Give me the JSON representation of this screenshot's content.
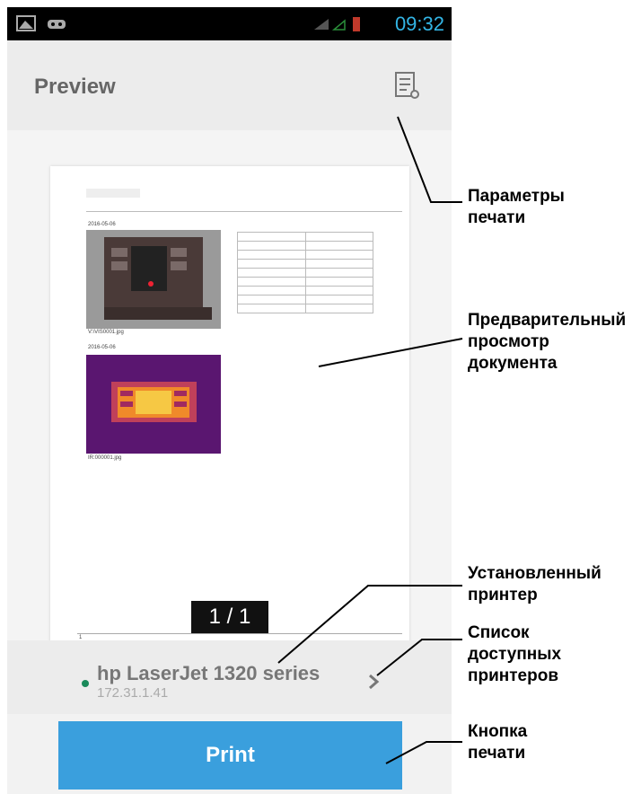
{
  "status_bar": {
    "time": "09:32"
  },
  "app_bar": {
    "title": "Preview",
    "options_icon": "print-settings-icon"
  },
  "document": {
    "date1": "2016-05-06",
    "caption1": "V:\\VIS0001.jpg",
    "date2": "2016-05-06",
    "caption2": "IR:000001.jpg",
    "page_number": "1"
  },
  "pager": {
    "label": "1 / 1"
  },
  "printer": {
    "name": "hp LaserJet 1320 series",
    "ip": "172.31.1.41"
  },
  "print_button": {
    "label": "Print"
  },
  "annotations": {
    "print_settings": "Параметры\nпечати",
    "doc_preview": "Предварительный\nпросмотр\nдокумента",
    "installed_printer": "Установленный\nпринтер",
    "printer_list": "Список\nдоступных\nпринтеров",
    "print_button": "Кнопка\nпечати"
  },
  "colors": {
    "accent": "#3a9fdd",
    "status_text": "#33b5e5",
    "online_dot": "#1a8a5a"
  }
}
